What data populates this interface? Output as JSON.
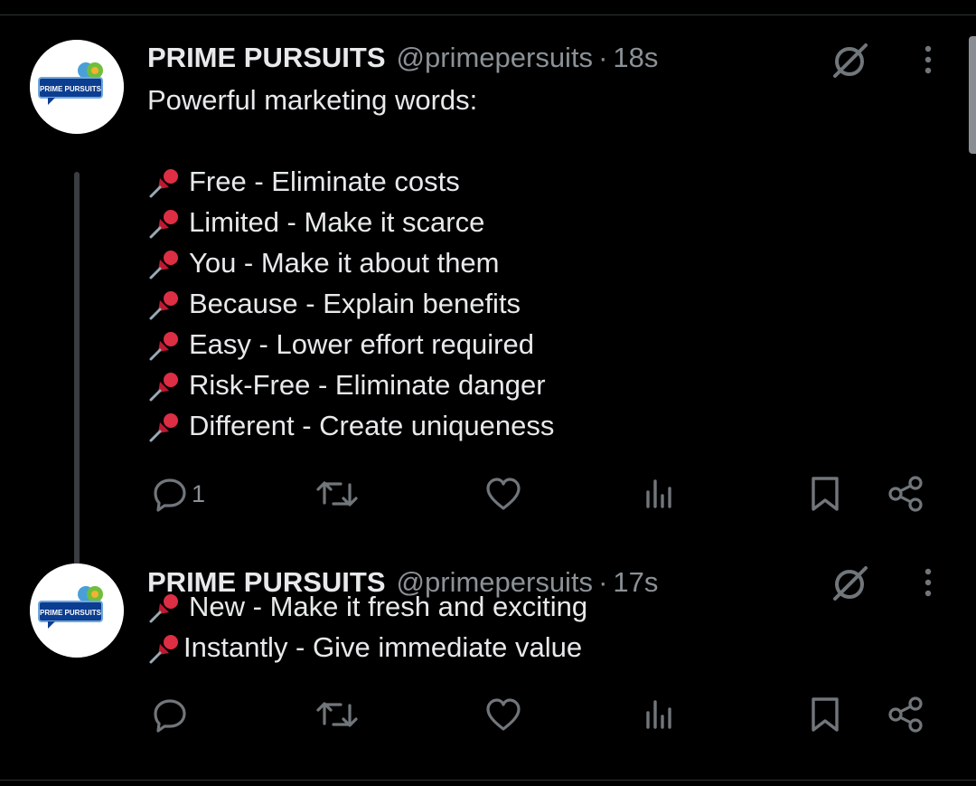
{
  "thread": [
    {
      "author": {
        "name": "PRIME PURSUITS",
        "handle": "@primepersuits",
        "avatar_text": "PRIME PURSUITS"
      },
      "separator": "·",
      "time": "18s",
      "lines": [
        {
          "pin": false,
          "text": "Powerful marketing words:"
        },
        {
          "pin": false,
          "text": ""
        },
        {
          "pin": true,
          "text": "Free - Eliminate costs"
        },
        {
          "pin": true,
          "text": "Limited - Make it scarce"
        },
        {
          "pin": true,
          "text": "You - Make it about them"
        },
        {
          "pin": true,
          "text": "Because - Explain benefits"
        },
        {
          "pin": true,
          "text": "Easy - Lower effort required"
        },
        {
          "pin": true,
          "text": "Risk-Free - Eliminate danger"
        },
        {
          "pin": true,
          "text": "Different - Create uniqueness"
        }
      ],
      "actions": {
        "reply_count": "1",
        "repost_count": "",
        "like_count": "",
        "view_count": ""
      }
    },
    {
      "author": {
        "name": "PRIME PURSUITS",
        "handle": "@primepersuits",
        "avatar_text": "PRIME PURSUITS"
      },
      "separator": "·",
      "time": "17s",
      "lines": [
        {
          "pin": true,
          "text": "New - Make it fresh and exciting"
        },
        {
          "pin": true,
          "text": "Instantly - Give immediate value"
        }
      ],
      "actions": {
        "reply_count": "",
        "repost_count": "",
        "like_count": "",
        "view_count": ""
      }
    }
  ],
  "icons": {
    "reply": "speech-bubble-icon",
    "repost": "repost-arrows-icon",
    "like": "heart-icon",
    "views": "bar-chart-icon",
    "bookmark": "bookmark-icon",
    "share": "share-nodes-icon",
    "grok": "grok-slash-circle-icon",
    "more": "vertical-ellipsis-icon",
    "pin": "pushpin-emoji-icon"
  },
  "colors": {
    "background": "#000000",
    "text": "#e7e9ea",
    "muted": "#8b9196",
    "icon": "#71767b",
    "pin_red": "#dd2e44"
  }
}
